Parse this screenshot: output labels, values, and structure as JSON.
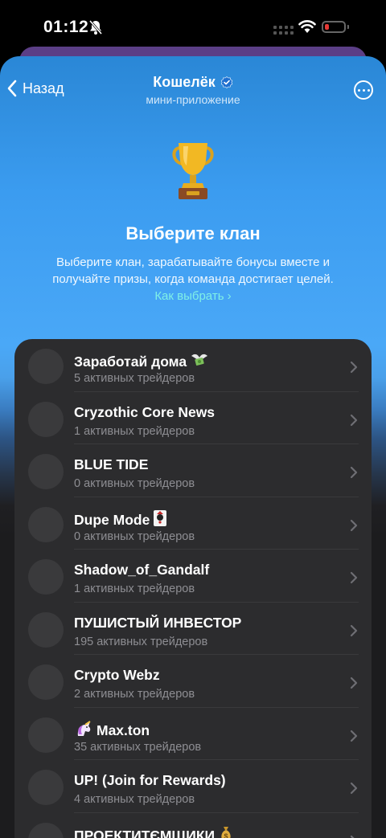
{
  "status": {
    "time": "01:12"
  },
  "nav": {
    "back_label": "Назад",
    "title": "Кошелёк",
    "subtitle": "мини-приложение"
  },
  "hero": {
    "heading": "Выберите клан",
    "description": "Выберите клан, зарабатывайте бонусы вместе и получайте призы, когда команда достигает целей.",
    "link_label": "Как выбрать",
    "link_color": "#7ff0e6"
  },
  "clans": [
    {
      "name": "Заработай дома",
      "suffix_icon": "money-wings",
      "traders": "5 активных трейдеров"
    },
    {
      "name": "Cryzothic Core News",
      "traders": "1 активных трейдеров"
    },
    {
      "name": "BLUE TIDE",
      "traders": "0 активных трейдеров"
    },
    {
      "name": "Dupe Mode",
      "suffix_icon": "joker-card",
      "traders": "0 активных трейдеров"
    },
    {
      "name": "Shadow_of_Gandalf",
      "traders": "1 активных трейдеров"
    },
    {
      "name": "ПУШИСТЫЙ ИНВЕСТОР",
      "traders": "195 активных трейдеров"
    },
    {
      "name": "Crypto Webz",
      "traders": "2 активных трейдеров"
    },
    {
      "name": "Max.ton",
      "prefix_icon": "unicorn",
      "traders": "35 активных трейдеров"
    },
    {
      "name": "UP! (Join for Rewards)",
      "traders": "4 активных трейдеров"
    },
    {
      "name": "ПРОЕКТИТЄМЩИКИ",
      "suffix_icon": "money-bag",
      "traders": ""
    }
  ],
  "colors": {
    "accent_blue": "#3b9cf0",
    "card_bg": "#2c2c2e",
    "battery_low": "#e53935"
  }
}
